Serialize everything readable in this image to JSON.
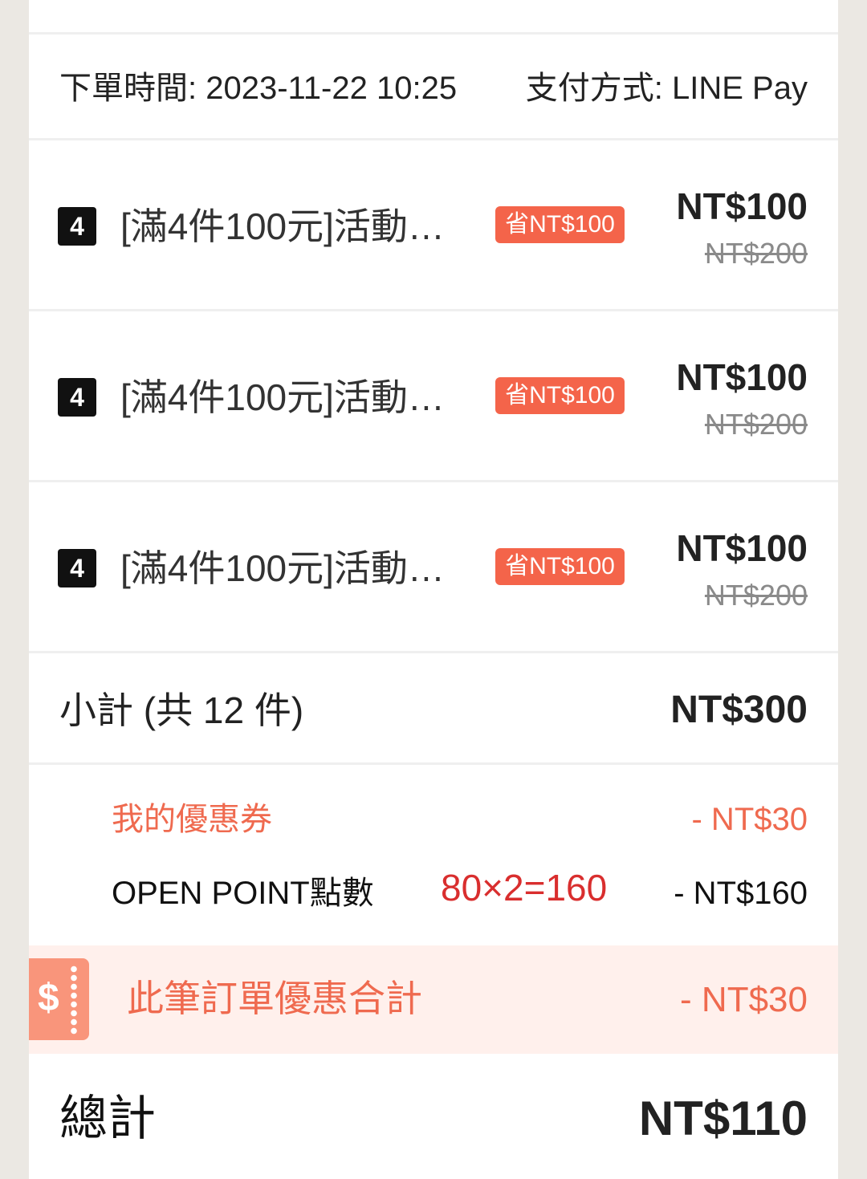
{
  "order": {
    "order_time": "下單時間: 2023-11-22 10:25",
    "payment_method": "支付方式: LINE Pay"
  },
  "items": [
    {
      "quantity": "4",
      "title": "[滿4件100元]活動…",
      "save_tag": "省NT$100",
      "price": "NT$100",
      "original_price": "NT$200"
    },
    {
      "quantity": "4",
      "title": "[滿4件100元]活動…",
      "save_tag": "省NT$100",
      "price": "NT$100",
      "original_price": "NT$200"
    },
    {
      "quantity": "4",
      "title": "[滿4件100元]活動…",
      "save_tag": "省NT$100",
      "price": "NT$100",
      "original_price": "NT$200"
    }
  ],
  "subtotal": {
    "label": "小計  (共 12 件)",
    "value": "NT$300"
  },
  "discounts": {
    "coupon_label": "我的優惠券",
    "coupon_value": "- NT$30",
    "points_label": "OPEN POINT點數",
    "points_note": "80×2=160",
    "points_value": "- NT$160"
  },
  "discount_total": {
    "icon_symbol": "$",
    "label": "此筆訂單優惠合計",
    "value": "- NT$30"
  },
  "total": {
    "label": "總計",
    "value": "NT$110"
  },
  "colors": {
    "accent": "#ef6a4f",
    "save_tag_bg": "#f4644a",
    "discount_band_bg": "#fff0ec",
    "ticket_icon": "#f9957b",
    "annotation": "#d92e2e",
    "page_bg": "#ebe8e3"
  }
}
